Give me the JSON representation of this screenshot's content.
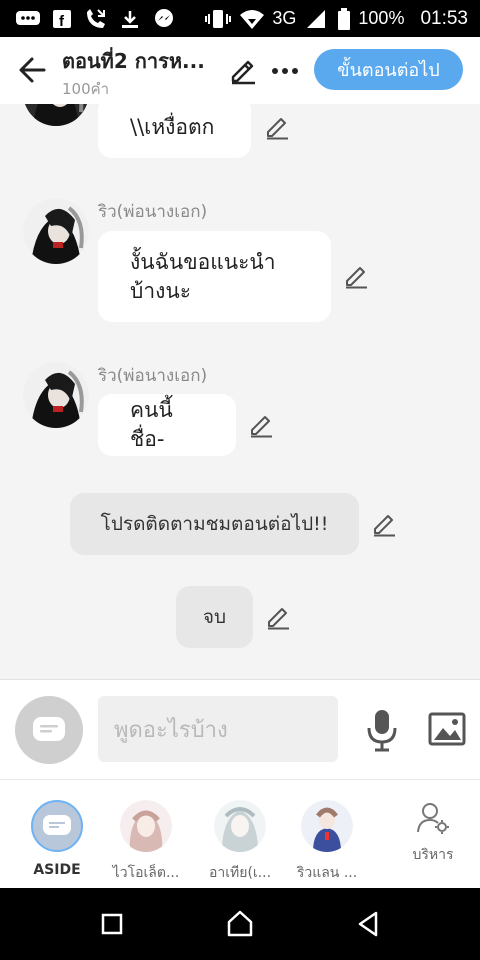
{
  "status_bar": {
    "network": "3G",
    "battery": "100%",
    "time": "01:53"
  },
  "header": {
    "title": "ตอนที่2 การห...",
    "word_count": "100คำ",
    "next_button": "ขั้นตอนต่อไป"
  },
  "messages": {
    "m0": {
      "text": "\\\\เหงื่อตก"
    },
    "m1": {
      "name": "ริว(พ่อนางเอก)",
      "line1": "งั้นฉันขอแนะนำ",
      "line2": "บ้างนะ"
    },
    "m2": {
      "name": "ริว(พ่อนางเอก)",
      "text": "คนนี้ชื่อ-"
    },
    "n1": {
      "text": "โปรดติดตามชมตอนต่อไป!!"
    },
    "n2": {
      "text": "จบ"
    }
  },
  "input": {
    "placeholder": "พูดอะไรบ้าง"
  },
  "characters": {
    "aside": "ASIDE",
    "c1": "ไวโอเล็ต...",
    "c2": "อาเทีย(เ...",
    "c3": "ริวแลน ...",
    "manage": "บริหาร"
  },
  "colors": {
    "accent": "#5aa9ee",
    "bubble": "#ffffff",
    "narration": "#e7e7e7",
    "background": "#f4f4f4"
  }
}
